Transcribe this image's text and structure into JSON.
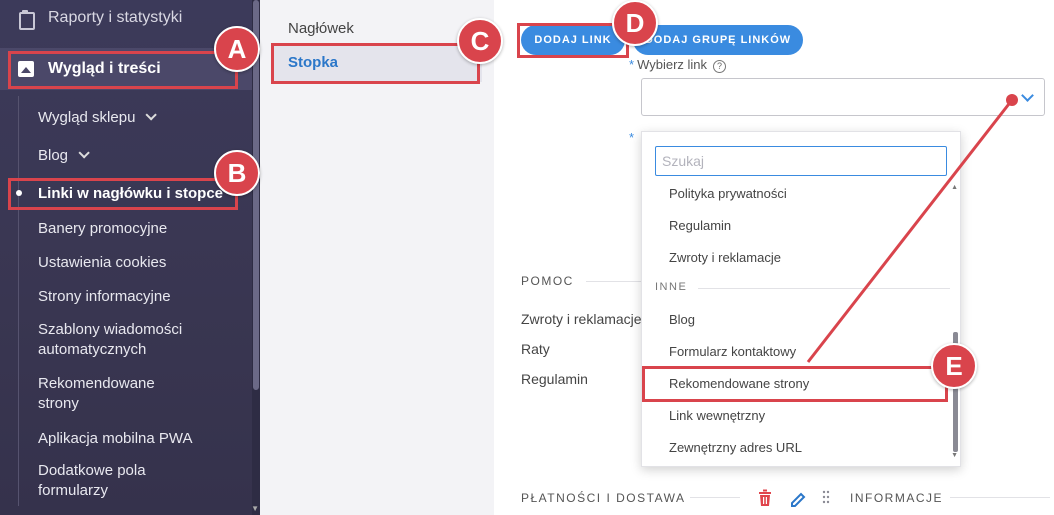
{
  "sidebar": {
    "top_item": "Raporty i statystyki",
    "active_section": "Wygląd i treści",
    "items": [
      {
        "label": "Wygląd sklepu",
        "chevron": true
      },
      {
        "label": "Blog",
        "chevron": true
      },
      {
        "label": "Linki w nagłówku i stopce",
        "current": true
      },
      {
        "label": "Banery promocyjne"
      },
      {
        "label": "Ustawienia cookies"
      },
      {
        "label": "Strony informacyjne"
      },
      {
        "label": "Szablony wiadomości automatycznych"
      },
      {
        "label": "Rekomendowane strony"
      },
      {
        "label": "Aplikacja mobilna PWA"
      },
      {
        "label": "Dodatkowe pola formularzy"
      }
    ]
  },
  "tabs": {
    "header": "Nagłówek",
    "footer": "Stopka"
  },
  "toolbar": {
    "add_link": "DODAJ LINK",
    "add_group": "DODAJ GRUPĘ LINKÓW"
  },
  "form": {
    "select_label": "Wybierz link",
    "required_mark": "*",
    "help_icon_glyph": "?"
  },
  "dropdown": {
    "search_placeholder": "Szukaj",
    "items_before": [
      "Polityka prywatności",
      "Regulamin",
      "Zwroty i reklamacje"
    ],
    "group_label": "INNE",
    "items_after": [
      "Blog",
      "Formularz kontaktowy",
      "Rekomendowane strony",
      "Link wewnętrzny",
      "Zewnętrzny adres URL"
    ]
  },
  "sections": {
    "pomoc": {
      "title": "POMOC",
      "links": [
        "Zwroty i reklamacje",
        "Raty",
        "Regulamin"
      ]
    },
    "platnosci": "PŁATNOŚCI I DOSTAWA",
    "informacje": "INFORMACJE"
  },
  "annotations": {
    "A": "A",
    "B": "B",
    "C": "C",
    "D": "D",
    "E": "E"
  },
  "colors": {
    "accent": "#3a8be0",
    "annotation_red": "#d9444c",
    "sidebar_bg": "#393651",
    "delete_red": "#e0454c"
  },
  "icons": [
    "clipboard-icon",
    "image-icon",
    "chevron-down-icon",
    "help-icon",
    "trash-icon",
    "pencil-icon",
    "drag-handle-icon"
  ]
}
